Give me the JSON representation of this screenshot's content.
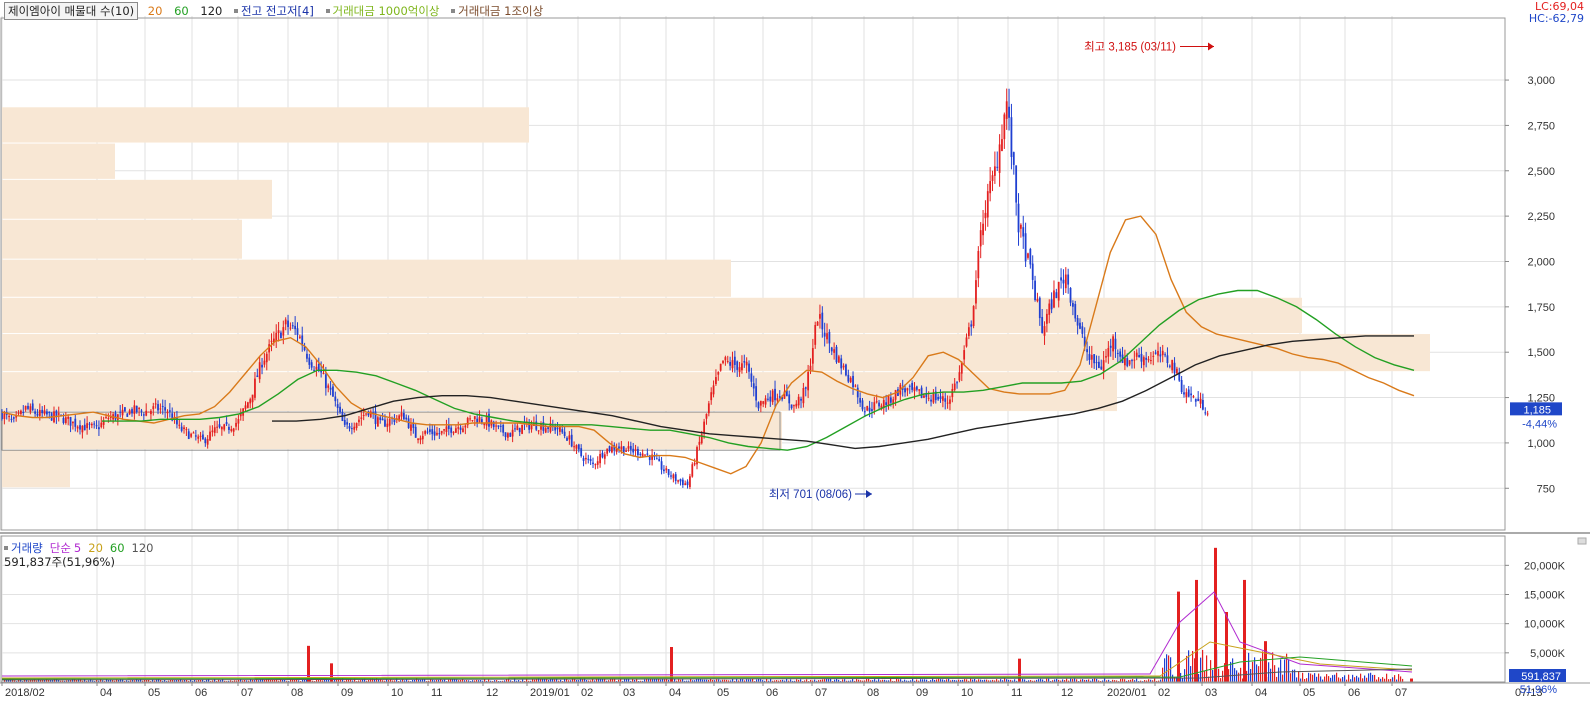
{
  "header": {
    "stock_label": "제이엠아이 매물대 수(10)",
    "ma_periods": [
      "20",
      "60",
      "120"
    ],
    "ma_colors": [
      "#d97a1a",
      "#23a023",
      "#222222"
    ],
    "legend_items": [
      "전고 전고저[4]",
      "거래대금 1000억이상",
      "거래대금 1조이상"
    ],
    "legend_colors": [
      "#1a33a8",
      "#7fb61c",
      "#7a4a2a"
    ],
    "lc": "LC:69,04",
    "hc": "HC:-62,79"
  },
  "volume_panel": {
    "label": "거래량",
    "sma_label": "단순",
    "periods": [
      "5",
      "20",
      "60",
      "120"
    ],
    "period_colors": [
      "#b12ad0",
      "#c8a21a",
      "#23a023",
      "#555555"
    ],
    "current": "591,837주(51,96%)",
    "badge_value": "591,837",
    "badge_pct": "51,96%"
  },
  "price_badge": {
    "value": "1,185",
    "change": "-4,44%"
  },
  "annotations": {
    "high": "최고 3,185 (03/11)",
    "low": "최저 701 (08/06)"
  },
  "colors": {
    "up": "#e32020",
    "down": "#1f3fd1",
    "volume_profile": "#f8e7d4",
    "grid": "#e2e2e2",
    "badge": "#1f47c8"
  },
  "chart_data": [
    {
      "type": "candlestick",
      "title": "제이엠아이",
      "x_ticks": [
        "2018/02",
        "04",
        "05",
        "06",
        "07",
        "08",
        "09",
        "10",
        "11",
        "12",
        "2019/01",
        "02",
        "03",
        "04",
        "05",
        "06",
        "07",
        "08",
        "09",
        "10",
        "11",
        "12",
        "2020/01",
        "02",
        "03",
        "04",
        "05",
        "06",
        "07"
      ],
      "x_axis_extra": "07/13",
      "y_ticks": [
        750,
        1000,
        1250,
        1500,
        1750,
        2000,
        2250,
        2500,
        2750,
        3000
      ],
      "ylim": [
        520,
        3320
      ],
      "close_series": {
        "x": [
          0,
          5,
          10,
          15,
          20,
          25,
          30,
          35,
          40,
          45,
          50,
          55,
          60,
          65,
          70,
          75,
          80,
          85,
          90,
          95,
          100,
          105,
          110,
          115,
          120,
          125,
          130,
          135,
          140,
          145,
          150,
          155,
          160,
          165,
          170,
          175,
          180,
          185,
          190,
          195,
          200,
          205,
          210,
          215,
          220,
          225,
          230,
          235,
          240,
          245,
          250,
          255,
          260,
          265,
          270,
          275,
          280,
          285,
          290,
          295,
          300,
          305,
          310,
          315,
          320,
          325,
          330,
          335,
          340,
          345,
          350,
          355,
          360,
          365,
          370,
          375,
          380,
          385,
          390,
          395,
          400,
          405,
          410,
          415,
          420,
          425,
          430,
          435,
          440,
          445,
          450,
          455,
          460,
          465,
          470,
          475,
          480,
          485,
          490,
          495,
          500,
          505,
          510,
          515,
          520,
          525,
          530,
          535,
          540,
          545,
          550,
          555,
          560,
          565,
          570,
          575,
          580,
          585,
          590,
          595,
          600,
          605,
          610,
          615,
          620,
          625
        ],
        "y": [
          1160,
          1110,
          1190,
          1160,
          1150,
          1140,
          1110,
          1090,
          1080,
          1140,
          1150,
          1180,
          1170,
          1190,
          1180,
          1080,
          1040,
          1010,
          1070,
          1080,
          1120,
          1250,
          1450,
          1560,
          1650,
          1610,
          1460,
          1380,
          1250,
          1080,
          1120,
          1180,
          1100,
          1130,
          1150,
          1040,
          1060,
          1050,
          1080,
          1100,
          1140,
          1120,
          1070,
          1050,
          1090,
          1100,
          1090,
          1080,
          1020,
          930,
          880,
          960,
          980,
          960,
          950,
          920,
          850,
          800,
          770,
          1000,
          1260,
          1450,
          1430,
          1420,
          1210,
          1260,
          1270,
          1200,
          1290,
          1700,
          1550,
          1430,
          1330,
          1180,
          1210,
          1230,
          1300,
          1280,
          1260,
          1250,
          1230,
          1380,
          1670,
          2250,
          2500,
          2880,
          2200,
          1950,
          1620,
          1810,
          1930,
          1650,
          1460,
          1420,
          1570,
          1440,
          1480,
          1470,
          1480,
          1440,
          1280,
          1240,
          1185
        ]
      },
      "moving_averages": [
        {
          "period": "20",
          "y": [
            1170,
            1150,
            1140,
            1140,
            1150,
            1160,
            1170,
            1150,
            1130,
            1120,
            1110,
            1130,
            1150,
            1160,
            1200,
            1280,
            1380,
            1480,
            1560,
            1580,
            1530,
            1430,
            1310,
            1220,
            1170,
            1150,
            1130,
            1110,
            1100,
            1100,
            1100,
            1110,
            1110,
            1110,
            1110,
            1100,
            1090,
            1090,
            1090,
            1070,
            1000,
            940,
            920,
            930,
            930,
            920,
            890,
            860,
            830,
            870,
            1000,
            1210,
            1330,
            1400,
            1390,
            1340,
            1300,
            1270,
            1250,
            1280,
            1360,
            1480,
            1500,
            1460,
            1380,
            1300,
            1280,
            1270,
            1270,
            1270,
            1290,
            1430,
            1740,
            2050,
            2230,
            2250,
            2150,
            1900,
            1720,
            1640,
            1600,
            1580,
            1560,
            1540,
            1520,
            1490,
            1470,
            1460,
            1440,
            1400,
            1360,
            1330,
            1290,
            1260
          ]
        },
        {
          "period": "60",
          "y": [
            1120,
            1120,
            1120,
            1130,
            1130,
            1130,
            1140,
            1160,
            1200,
            1270,
            1350,
            1400,
            1400,
            1390,
            1370,
            1330,
            1290,
            1240,
            1190,
            1160,
            1140,
            1120,
            1110,
            1100,
            1100,
            1100,
            1090,
            1080,
            1070,
            1070,
            1050,
            1030,
            1000,
            980,
            970,
            960,
            980,
            1030,
            1090,
            1150,
            1200,
            1240,
            1270,
            1280,
            1280,
            1290,
            1310,
            1330,
            1330,
            1330,
            1340,
            1380,
            1450,
            1550,
            1650,
            1730,
            1790,
            1820,
            1840,
            1840,
            1800,
            1750,
            1680,
            1600,
            1530,
            1470,
            1430,
            1400
          ]
        },
        {
          "period": "120",
          "y": [
            1120,
            1120,
            1130,
            1150,
            1190,
            1230,
            1250,
            1260,
            1260,
            1250,
            1230,
            1210,
            1190,
            1170,
            1150,
            1120,
            1090,
            1070,
            1050,
            1040,
            1030,
            1020,
            1010,
            990,
            970,
            980,
            1000,
            1020,
            1050,
            1080,
            1100,
            1120,
            1140,
            1160,
            1190,
            1230,
            1290,
            1360,
            1430,
            1480,
            1510,
            1540,
            1560,
            1570,
            1580,
            1590,
            1590,
            1590
          ]
        }
      ],
      "volume_profile_labels_visible": false,
      "markers": {
        "high": 3185,
        "low": 701
      }
    },
    {
      "type": "bar",
      "title": "거래량",
      "y_ticks": [
        "5,000K",
        "10,000K",
        "15,000K",
        "20,000K"
      ],
      "y_tick_values": [
        5000,
        10000,
        15000,
        20000
      ],
      "ylim": [
        0,
        24000
      ],
      "spikes": [
        {
          "x": 307,
          "value": 6200
        },
        {
          "x": 330,
          "value": 3200
        },
        {
          "x": 670,
          "value": 6000
        },
        {
          "x": 1018,
          "value": 4000
        },
        {
          "x": 1177,
          "value": 15500
        },
        {
          "x": 1195,
          "value": 17500
        },
        {
          "x": 1214,
          "value": 23000
        },
        {
          "x": 1225,
          "value": 12000
        },
        {
          "x": 1243,
          "value": 17500
        },
        {
          "x": 1264,
          "value": 7000
        },
        {
          "x": 1410,
          "value": 592
        }
      ]
    }
  ]
}
